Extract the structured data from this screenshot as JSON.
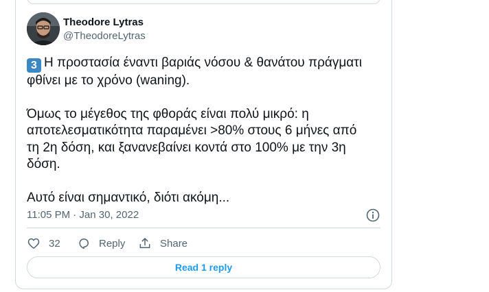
{
  "tweet": {
    "author_name": "Theodore Lytras",
    "author_handle": "@TheodoreLytras",
    "keycap": "3",
    "line1": "Η προστασία έναντι βαριάς νόσου & θανάτου πράγματι φθίνει με το χρόνο (waning).",
    "para2": "Όμως το μέγεθος της φθοράς είναι πολύ μικρό: η αποτελεσματικότητα παραμένει >80% στους 6 μήνες από τη 2η δόση, και ξανανεβαίνει κοντά στο 100% με την 3η δόση.",
    "para3": "Αυτό είναι σημαντικό, διότι ακόμη...",
    "timestamp": "11:05 PM · Jan 30, 2022",
    "like_count": "32",
    "reply_label": "Reply",
    "share_label": "Share",
    "read_reply_label": "Read 1 reply"
  },
  "icons": {
    "info": "info-icon",
    "like": "heart-icon",
    "reply": "reply-bubble-icon",
    "share": "share-icon"
  },
  "colors": {
    "accent": "#1d9bf0",
    "secondary_text": "#536471",
    "border": "#cfd9de",
    "keycap": "#3b88c3"
  }
}
